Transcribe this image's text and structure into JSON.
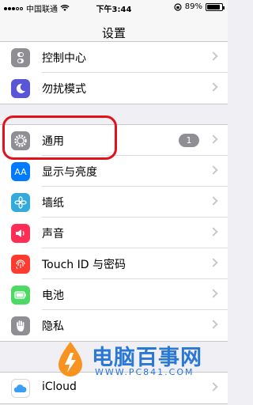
{
  "status": {
    "carrier": "中国联通",
    "time": "下午3:44",
    "battery": "89%",
    "battery_level": 0.89
  },
  "nav": {
    "title": "设置"
  },
  "groups": [
    {
      "items": [
        {
          "label": "控制中心",
          "icon": "toggle-icon",
          "color": "#8e8e93"
        },
        {
          "label": "勿扰模式",
          "icon": "moon-icon",
          "color": "#5856d6"
        }
      ]
    },
    {
      "items": [
        {
          "label": "通用",
          "icon": "gear-icon",
          "color": "#8e8e93",
          "badge": "1"
        },
        {
          "label": "显示与亮度",
          "icon": "text-size-icon",
          "color": "#007aff"
        },
        {
          "label": "墙纸",
          "icon": "flower-icon",
          "color": "#34aadc"
        },
        {
          "label": "声音",
          "icon": "speaker-icon",
          "color": "#ff2d55"
        },
        {
          "label": "Touch ID 与密码",
          "icon": "fingerprint-icon",
          "color": "#ff3b30"
        },
        {
          "label": "电池",
          "icon": "battery-icon",
          "color": "#4cd964"
        },
        {
          "label": "隐私",
          "icon": "hand-icon",
          "color": "#8e8e93"
        }
      ]
    },
    {
      "items": [
        {
          "label": "iCloud",
          "icon": "cloud-icon",
          "color": "#ffffff"
        }
      ]
    }
  ],
  "watermark": {
    "name": "电脑百事网",
    "url": "WWW.PC841.COM"
  }
}
